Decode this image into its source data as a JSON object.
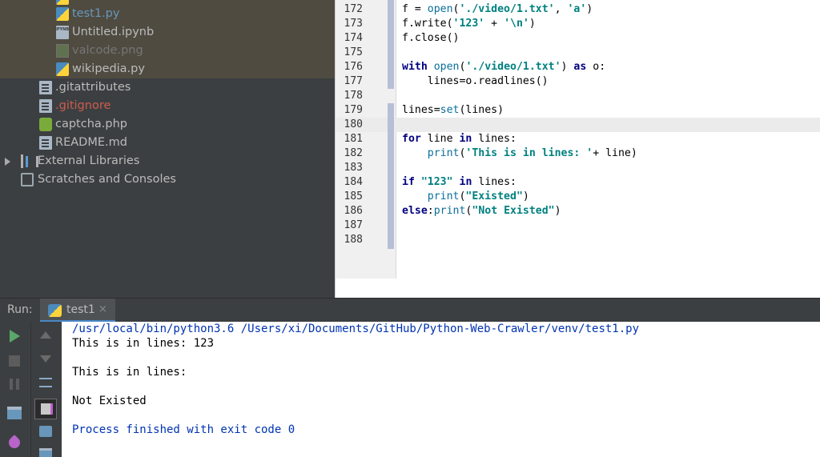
{
  "project_tree": {
    "items": [
      {
        "label": "test1.py",
        "icon": "python-file-icon",
        "color": "#6897bb"
      },
      {
        "label": "Untitled.ipynb",
        "icon": "notebook-file-icon",
        "color": "#bbbbbb"
      },
      {
        "label": "valcode.png",
        "icon": "image-file-icon",
        "color": "#757575"
      },
      {
        "label": "wikipedia.py",
        "icon": "python-file-icon",
        "color": "#bbbbbb"
      },
      {
        "label": ".gitattributes",
        "icon": "text-file-icon",
        "color": "#bbbbbb"
      },
      {
        "label": ".gitignore",
        "icon": "text-file-icon",
        "color": "#cc5c4e"
      },
      {
        "label": "captcha.php",
        "icon": "php-file-icon",
        "color": "#bbbbbb"
      },
      {
        "label": "README.md",
        "icon": "text-file-icon",
        "color": "#bbbbbb"
      },
      {
        "label": "External Libraries",
        "icon": "library-icon",
        "color": "#bbbbbb"
      },
      {
        "label": "Scratches and Consoles",
        "icon": "scratch-icon",
        "color": "#bbbbbb"
      }
    ]
  },
  "editor": {
    "line_numbers": [
      "172",
      "173",
      "174",
      "175",
      "176",
      "177",
      "178",
      "179",
      "180",
      "181",
      "182",
      "183",
      "184",
      "185",
      "186",
      "187",
      "188"
    ],
    "code": {
      "l172_a": "f = ",
      "l172_fn": "open",
      "l172_b": "(",
      "l172_s1": "'./video/1.txt'",
      "l172_c": ", ",
      "l172_s2": "'a'",
      "l172_d": ")",
      "l173_a": "f.write(",
      "l173_s1": "'123'",
      "l173_b": " + ",
      "l173_s2": "'\\n'",
      "l173_c": ")",
      "l174": "f.close()",
      "l176_kw": "with",
      "l176_a": " ",
      "l176_fn": "open",
      "l176_b": "(",
      "l176_s": "'./video/1.txt'",
      "l176_c": ") ",
      "l176_kw2": "as",
      "l176_d": " o:",
      "l177": "    lines=o.readlines()",
      "l179_a": "lines=",
      "l179_fn": "set",
      "l179_b": "(lines)",
      "l181_kw": "for",
      "l181_a": " line ",
      "l181_kw2": "in",
      "l181_b": " lines:",
      "l182_a": "    ",
      "l182_fn": "print",
      "l182_b": "(",
      "l182_s": "'This is in lines: '",
      "l182_c": "+ line)",
      "l184_kw": "if",
      "l184_a": " ",
      "l184_s": "\"123\"",
      "l184_b": " ",
      "l184_kw2": "in",
      "l184_c": " lines:",
      "l185_a": "    ",
      "l185_fn": "print",
      "l185_b": "(",
      "l185_s": "\"Existed\"",
      "l185_c": ")",
      "l186_kw": "else",
      "l186_a": ":",
      "l186_fn": "print",
      "l186_b": "(",
      "l186_s": "\"Not Existed\"",
      "l186_c": ")"
    }
  },
  "run_panel": {
    "label": "Run:",
    "tab_name": "test1",
    "tab_close": "×",
    "output": [
      "/usr/local/bin/python3.6 /Users/xi/Documents/GitHub/Python-Web-Crawler/venv/test1.py",
      "This is in lines: 123",
      "",
      "This is in lines: ",
      "",
      "Not Existed",
      "",
      "Process finished with exit code 0"
    ]
  },
  "colors": {
    "accent_tab_underline": "#4a88c7",
    "run_green": "#59a869",
    "console_path_blue": "#0033b3"
  }
}
